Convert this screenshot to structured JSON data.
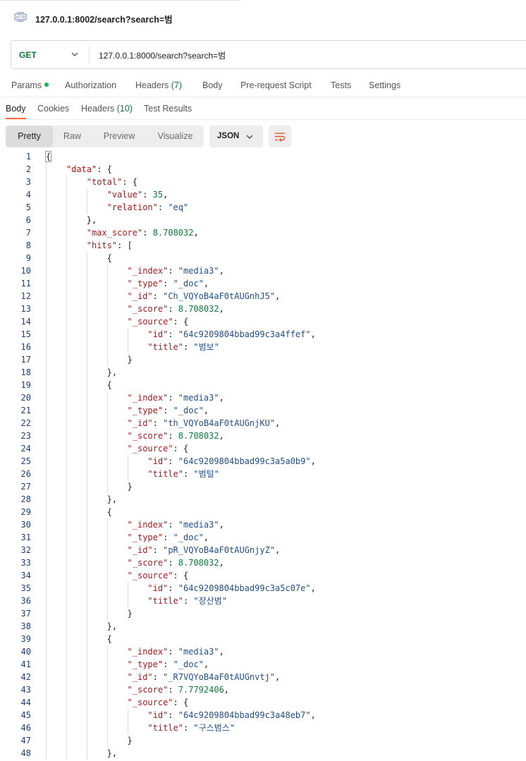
{
  "window": {
    "title": "127.0.0.1:8002/search?search=범",
    "icon": "http-request-icon"
  },
  "request": {
    "method": "GET",
    "url": "127.0.0.1:8000/search?search=범"
  },
  "request_tabs": [
    {
      "label": "Params",
      "count": "",
      "indicator": true
    },
    {
      "label": "Authorization",
      "count": ""
    },
    {
      "label": "Headers",
      "count": "(7)"
    },
    {
      "label": "Body",
      "count": ""
    },
    {
      "label": "Pre-request Script",
      "count": ""
    },
    {
      "label": "Tests",
      "count": ""
    },
    {
      "label": "Settings",
      "count": ""
    }
  ],
  "response_tabs": [
    {
      "label": "Body",
      "count": "",
      "active": true
    },
    {
      "label": "Cookies",
      "count": ""
    },
    {
      "label": "Headers",
      "count": "(10)"
    },
    {
      "label": "Test Results",
      "count": ""
    }
  ],
  "view_modes": [
    {
      "label": "Pretty",
      "active": true
    },
    {
      "label": "Raw"
    },
    {
      "label": "Preview"
    },
    {
      "label": "Visualize"
    }
  ],
  "format": {
    "selected": "JSON",
    "wrap_icon": "text-wrap-icon"
  },
  "colors": {
    "accent": "#ff6c37",
    "key": "#a81a1a",
    "string": "#1f4f8f",
    "number": "#0e7a3b",
    "method": "#0e7a3b"
  },
  "code_lines": [
    {
      "n": "1",
      "indent": 0,
      "t": [
        [
          "p",
          "{"
        ]
      ]
    },
    {
      "n": "2",
      "indent": 1,
      "t": [
        [
          "k",
          "\"data\""
        ],
        [
          "p",
          ": {"
        ]
      ]
    },
    {
      "n": "3",
      "indent": 2,
      "t": [
        [
          "k",
          "\"total\""
        ],
        [
          "p",
          ": {"
        ]
      ]
    },
    {
      "n": "4",
      "indent": 3,
      "t": [
        [
          "k",
          "\"value\""
        ],
        [
          "p",
          ": "
        ],
        [
          "n",
          "35"
        ],
        [
          "p",
          ","
        ]
      ]
    },
    {
      "n": "5",
      "indent": 3,
      "t": [
        [
          "k",
          "\"relation\""
        ],
        [
          "p",
          ": "
        ],
        [
          "s",
          "\"eq\""
        ]
      ]
    },
    {
      "n": "6",
      "indent": 2,
      "t": [
        [
          "p",
          "},"
        ]
      ]
    },
    {
      "n": "7",
      "indent": 2,
      "t": [
        [
          "k",
          "\"max_score\""
        ],
        [
          "p",
          ": "
        ],
        [
          "n",
          "8.708032"
        ],
        [
          "p",
          ","
        ]
      ]
    },
    {
      "n": "8",
      "indent": 2,
      "t": [
        [
          "k",
          "\"hits\""
        ],
        [
          "p",
          ": ["
        ]
      ]
    },
    {
      "n": "9",
      "indent": 3,
      "t": [
        [
          "p",
          "{"
        ]
      ]
    },
    {
      "n": "10",
      "indent": 4,
      "t": [
        [
          "k",
          "\"_index\""
        ],
        [
          "p",
          ": "
        ],
        [
          "s",
          "\"media3\""
        ],
        [
          "p",
          ","
        ]
      ]
    },
    {
      "n": "11",
      "indent": 4,
      "t": [
        [
          "k",
          "\"_type\""
        ],
        [
          "p",
          ": "
        ],
        [
          "s",
          "\"_doc\""
        ],
        [
          "p",
          ","
        ]
      ]
    },
    {
      "n": "12",
      "indent": 4,
      "t": [
        [
          "k",
          "\"_id\""
        ],
        [
          "p",
          ": "
        ],
        [
          "s",
          "\"Ch_VQYoB4aF0tAUGnhJ5\""
        ],
        [
          "p",
          ","
        ]
      ]
    },
    {
      "n": "13",
      "indent": 4,
      "t": [
        [
          "k",
          "\"_score\""
        ],
        [
          "p",
          ": "
        ],
        [
          "n",
          "8.708032"
        ],
        [
          "p",
          ","
        ]
      ]
    },
    {
      "n": "14",
      "indent": 4,
      "t": [
        [
          "k",
          "\"_source\""
        ],
        [
          "p",
          ": {"
        ]
      ]
    },
    {
      "n": "15",
      "indent": 5,
      "t": [
        [
          "k",
          "\"id\""
        ],
        [
          "p",
          ": "
        ],
        [
          "s",
          "\"64c9209804bbad99c3a4ffef\""
        ],
        [
          "p",
          ","
        ]
      ]
    },
    {
      "n": "16",
      "indent": 5,
      "t": [
        [
          "k",
          "\"title\""
        ],
        [
          "p",
          ": "
        ],
        [
          "s",
          "\"범보\""
        ]
      ]
    },
    {
      "n": "17",
      "indent": 4,
      "t": [
        [
          "p",
          "}"
        ]
      ]
    },
    {
      "n": "18",
      "indent": 3,
      "t": [
        [
          "p",
          "},"
        ]
      ]
    },
    {
      "n": "19",
      "indent": 3,
      "t": [
        [
          "p",
          "{"
        ]
      ]
    },
    {
      "n": "20",
      "indent": 4,
      "t": [
        [
          "k",
          "\"_index\""
        ],
        [
          "p",
          ": "
        ],
        [
          "s",
          "\"media3\""
        ],
        [
          "p",
          ","
        ]
      ]
    },
    {
      "n": "21",
      "indent": 4,
      "t": [
        [
          "k",
          "\"_type\""
        ],
        [
          "p",
          ": "
        ],
        [
          "s",
          "\"_doc\""
        ],
        [
          "p",
          ","
        ]
      ]
    },
    {
      "n": "22",
      "indent": 4,
      "t": [
        [
          "k",
          "\"_id\""
        ],
        [
          "p",
          ": "
        ],
        [
          "s",
          "\"th_VQYoB4aF0tAUGnjKU\""
        ],
        [
          "p",
          ","
        ]
      ]
    },
    {
      "n": "23",
      "indent": 4,
      "t": [
        [
          "k",
          "\"_score\""
        ],
        [
          "p",
          ": "
        ],
        [
          "n",
          "8.708032"
        ],
        [
          "p",
          ","
        ]
      ]
    },
    {
      "n": "24",
      "indent": 4,
      "t": [
        [
          "k",
          "\"_source\""
        ],
        [
          "p",
          ": {"
        ]
      ]
    },
    {
      "n": "25",
      "indent": 5,
      "t": [
        [
          "k",
          "\"id\""
        ],
        [
          "p",
          ": "
        ],
        [
          "s",
          "\"64c9209804bbad99c3a5a0b9\""
        ],
        [
          "p",
          ","
        ]
      ]
    },
    {
      "n": "26",
      "indent": 5,
      "t": [
        [
          "k",
          "\"title\""
        ],
        [
          "p",
          ": "
        ],
        [
          "s",
          "\"범털\""
        ]
      ]
    },
    {
      "n": "27",
      "indent": 4,
      "t": [
        [
          "p",
          "}"
        ]
      ]
    },
    {
      "n": "28",
      "indent": 3,
      "t": [
        [
          "p",
          "},"
        ]
      ]
    },
    {
      "n": "29",
      "indent": 3,
      "t": [
        [
          "p",
          "{"
        ]
      ]
    },
    {
      "n": "30",
      "indent": 4,
      "t": [
        [
          "k",
          "\"_index\""
        ],
        [
          "p",
          ": "
        ],
        [
          "s",
          "\"media3\""
        ],
        [
          "p",
          ","
        ]
      ]
    },
    {
      "n": "31",
      "indent": 4,
      "t": [
        [
          "k",
          "\"_type\""
        ],
        [
          "p",
          ": "
        ],
        [
          "s",
          "\"_doc\""
        ],
        [
          "p",
          ","
        ]
      ]
    },
    {
      "n": "32",
      "indent": 4,
      "t": [
        [
          "k",
          "\"_id\""
        ],
        [
          "p",
          ": "
        ],
        [
          "s",
          "\"pR_VQYoB4aF0tAUGnjyZ\""
        ],
        [
          "p",
          ","
        ]
      ]
    },
    {
      "n": "33",
      "indent": 4,
      "t": [
        [
          "k",
          "\"_score\""
        ],
        [
          "p",
          ": "
        ],
        [
          "n",
          "8.708032"
        ],
        [
          "p",
          ","
        ]
      ]
    },
    {
      "n": "34",
      "indent": 4,
      "t": [
        [
          "k",
          "\"_source\""
        ],
        [
          "p",
          ": {"
        ]
      ]
    },
    {
      "n": "35",
      "indent": 5,
      "t": [
        [
          "k",
          "\"id\""
        ],
        [
          "p",
          ": "
        ],
        [
          "s",
          "\"64c9209804bbad99c3a5c07e\""
        ],
        [
          "p",
          ","
        ]
      ]
    },
    {
      "n": "36",
      "indent": 5,
      "t": [
        [
          "k",
          "\"title\""
        ],
        [
          "p",
          ": "
        ],
        [
          "s",
          "\"장산범\""
        ]
      ]
    },
    {
      "n": "37",
      "indent": 4,
      "t": [
        [
          "p",
          "}"
        ]
      ]
    },
    {
      "n": "38",
      "indent": 3,
      "t": [
        [
          "p",
          "},"
        ]
      ]
    },
    {
      "n": "39",
      "indent": 3,
      "t": [
        [
          "p",
          "{"
        ]
      ]
    },
    {
      "n": "40",
      "indent": 4,
      "t": [
        [
          "k",
          "\"_index\""
        ],
        [
          "p",
          ": "
        ],
        [
          "s",
          "\"media3\""
        ],
        [
          "p",
          ","
        ]
      ]
    },
    {
      "n": "41",
      "indent": 4,
      "t": [
        [
          "k",
          "\"_type\""
        ],
        [
          "p",
          ": "
        ],
        [
          "s",
          "\"_doc\""
        ],
        [
          "p",
          ","
        ]
      ]
    },
    {
      "n": "42",
      "indent": 4,
      "t": [
        [
          "k",
          "\"_id\""
        ],
        [
          "p",
          ": "
        ],
        [
          "s",
          "\"_R7VQYoB4aF0tAUGnvtj\""
        ],
        [
          "p",
          ","
        ]
      ]
    },
    {
      "n": "43",
      "indent": 4,
      "t": [
        [
          "k",
          "\"_score\""
        ],
        [
          "p",
          ": "
        ],
        [
          "n",
          "7.7792406"
        ],
        [
          "p",
          ","
        ]
      ]
    },
    {
      "n": "44",
      "indent": 4,
      "t": [
        [
          "k",
          "\"_source\""
        ],
        [
          "p",
          ": {"
        ]
      ]
    },
    {
      "n": "45",
      "indent": 5,
      "t": [
        [
          "k",
          "\"id\""
        ],
        [
          "p",
          ": "
        ],
        [
          "s",
          "\"64c9209804bbad99c3a48eb7\""
        ],
        [
          "p",
          ","
        ]
      ]
    },
    {
      "n": "46",
      "indent": 5,
      "t": [
        [
          "k",
          "\"title\""
        ],
        [
          "p",
          ": "
        ],
        [
          "s",
          "\"구스범스\""
        ]
      ]
    },
    {
      "n": "47",
      "indent": 4,
      "t": [
        [
          "p",
          "}"
        ]
      ]
    },
    {
      "n": "48",
      "indent": 3,
      "t": [
        [
          "p",
          "},"
        ]
      ]
    }
  ]
}
